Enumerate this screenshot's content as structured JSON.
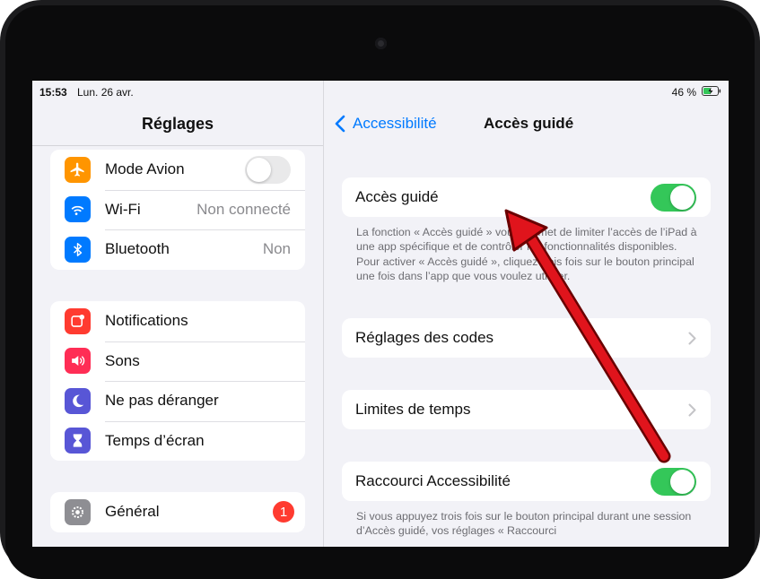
{
  "status_bar": {
    "time": "15:53",
    "date": "Lun. 26 avr.",
    "battery_percent": "46 %"
  },
  "sidebar": {
    "title": "Réglages",
    "groups": [
      {
        "items": [
          {
            "label": "Mode Avion",
            "icon": "airplane-icon",
            "icon_color": "#ff9500",
            "toggle": "off"
          },
          {
            "label": "Wi-Fi",
            "icon": "wifi-icon",
            "icon_color": "#007aff",
            "value": "Non connecté"
          },
          {
            "label": "Bluetooth",
            "icon": "bluetooth-icon",
            "icon_color": "#007aff",
            "value": "Non"
          }
        ]
      },
      {
        "items": [
          {
            "label": "Notifications",
            "icon": "notifications-icon",
            "icon_color": "#ff3b30"
          },
          {
            "label": "Sons",
            "icon": "speaker-icon",
            "icon_color": "#ff2d55"
          },
          {
            "label": "Ne pas déranger",
            "icon": "moon-icon",
            "icon_color": "#5856d6"
          },
          {
            "label": "Temps d’écran",
            "icon": "hourglass-icon",
            "icon_color": "#5856d6"
          }
        ]
      },
      {
        "items": [
          {
            "label": "Général",
            "icon": "gear-icon",
            "icon_color": "#8e8e93",
            "badge": "1"
          }
        ]
      }
    ]
  },
  "detail": {
    "back_label": "Accessibilité",
    "title": "Accès guidé",
    "guided_access": {
      "label": "Accès guidé",
      "toggle": "on"
    },
    "description": "La fonction « Accès guidé » vous permet de limiter l’accès de l’iPad à une app spécifique et de contrôler les fonctionnalités disponibles. Pour activer « Accès guidé », cliquez trois fois sur le bouton principal une fois dans l’app que vous voulez utiliser.",
    "passcode_settings": {
      "label": "Réglages des codes"
    },
    "time_limits": {
      "label": "Limites de temps"
    },
    "accessibility_shortcut": {
      "label": "Raccourci Accessibilité",
      "toggle": "on"
    },
    "shortcut_description": "Si vous appuyez trois fois sur le bouton principal durant une session d’Accès guidé, vos réglages « Raccourci"
  },
  "colors": {
    "accent": "#007aff",
    "switch_on": "#34c759",
    "annotation_arrow": "#e0141c"
  }
}
